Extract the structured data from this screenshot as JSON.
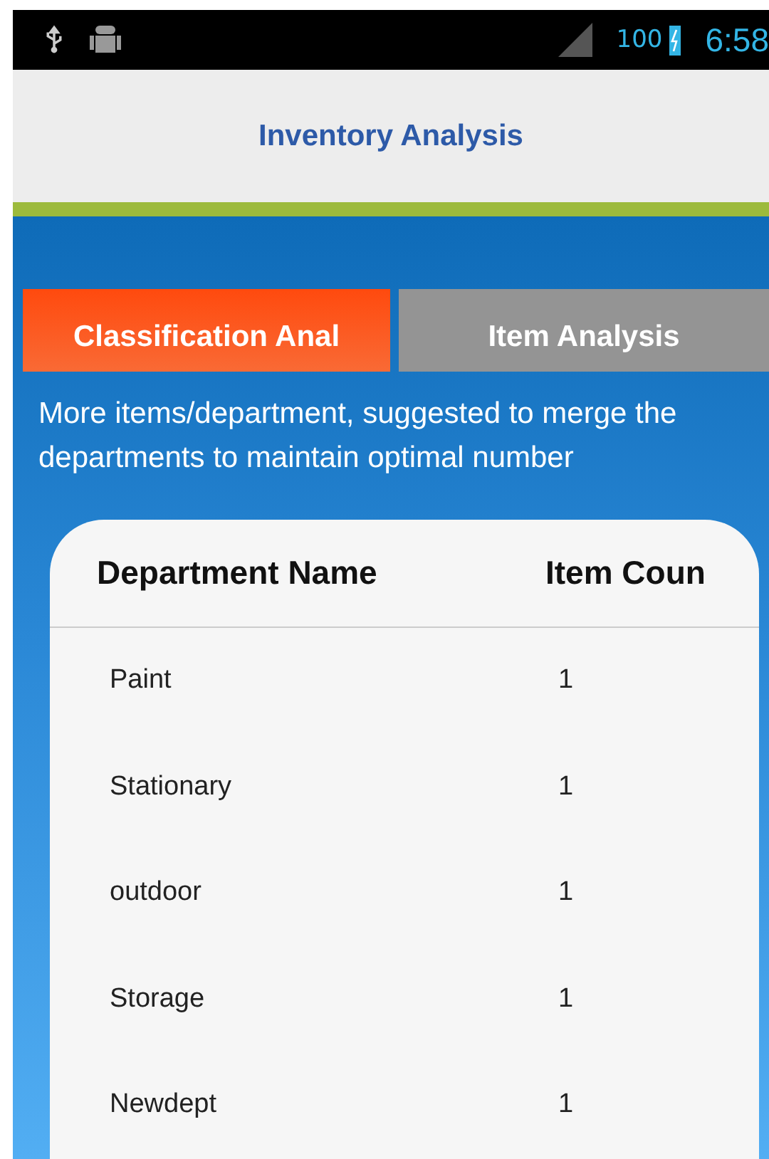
{
  "status_bar": {
    "battery_text": "100",
    "time": "6:58"
  },
  "title": "Inventory Analysis",
  "tabs": [
    {
      "label": "Classification Anal",
      "selected": true
    },
    {
      "label": "Item Analysis",
      "selected": false
    }
  ],
  "message": "More items/department, suggested to merge the departments to maintain optimal number",
  "table": {
    "columns": [
      "Department Name",
      "Item Coun"
    ],
    "rows": [
      [
        "Paint",
        "1"
      ],
      [
        "Stationary",
        "1"
      ],
      [
        "outdoor",
        "1"
      ],
      [
        "Storage",
        "1"
      ],
      [
        "Newdept",
        "1"
      ]
    ]
  }
}
